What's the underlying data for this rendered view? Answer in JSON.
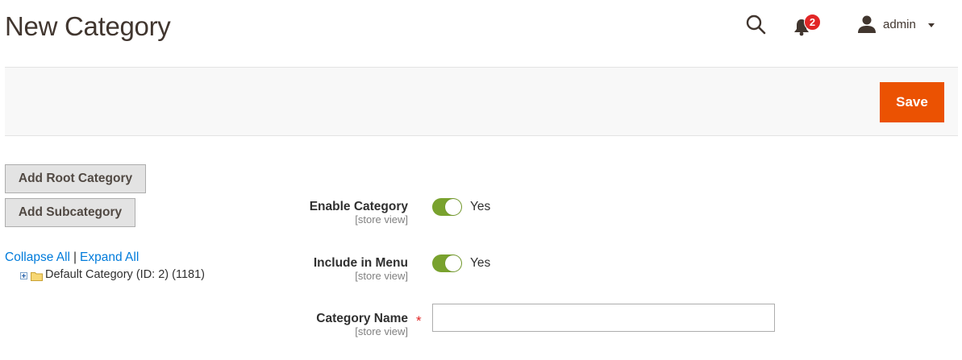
{
  "page": {
    "title": "New Category"
  },
  "header": {
    "notifications_count": "2",
    "user_name": "admin"
  },
  "actions": {
    "save_label": "Save"
  },
  "tree": {
    "add_root_label": "Add Root Category",
    "add_sub_label": "Add Subcategory",
    "collapse_all": "Collapse All",
    "separator": "|",
    "expand_all": "Expand All",
    "root_node": "Default Category (ID: 2) (1181)"
  },
  "form": {
    "enable_category": {
      "label": "Enable Category",
      "scope": "[store view]",
      "value": "Yes"
    },
    "include_in_menu": {
      "label": "Include in Menu",
      "scope": "[store view]",
      "value": "Yes"
    },
    "category_name": {
      "label": "Category Name",
      "scope": "[store view]",
      "required_mark": "*",
      "value": ""
    }
  },
  "colors": {
    "accent": "#eb5202",
    "link": "#007bdb",
    "toggle_on": "#79a22e",
    "badge": "#e22626"
  },
  "icons": [
    "search-icon",
    "bell-icon",
    "user-icon",
    "chevron-down-icon",
    "expand-plus-icon",
    "folder-icon"
  ]
}
